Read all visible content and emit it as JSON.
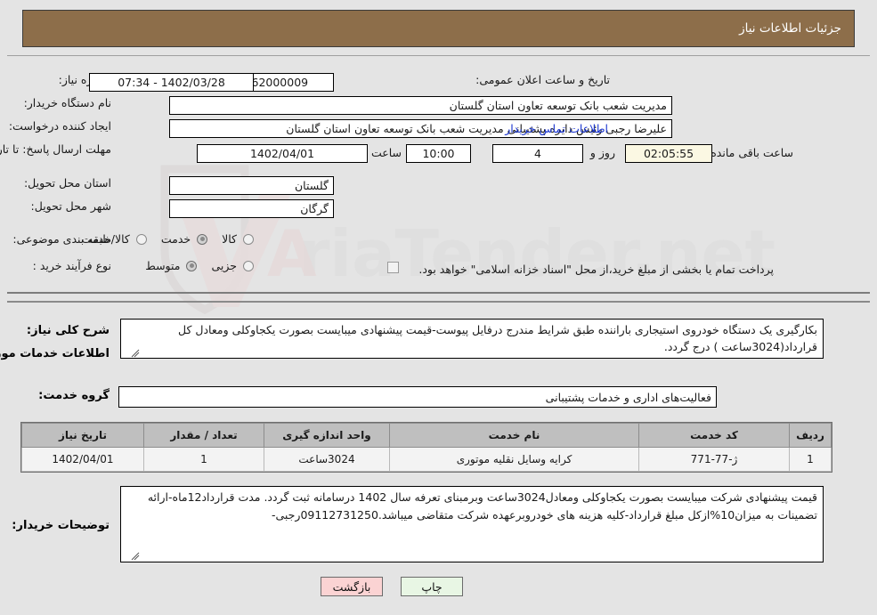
{
  "header": {
    "title": "جزئیات اطلاعات نیاز"
  },
  "form": {
    "need_number_label": "شماره نیاز:",
    "need_number_value": "1102003562000009",
    "public_announce_label": "تاریخ و ساعت اعلان عمومی:",
    "public_announce_value": "1402/03/28 - 07:34",
    "buyer_org_label": "نام دستگاه خریدار:",
    "buyer_org_value": "مدیریت شعب بانک توسعه تعاون استان گلستان",
    "requester_label": "ایجاد کننده درخواست:",
    "requester_value": "علیرضا رجبی رئیس دایره پشتیبانی مدیریت شعب بانک توسعه تعاون استان گلستان",
    "contact_link": "اطلاعات تماس خریدار",
    "deadline_label": "مهلت ارسال پاسخ: تا تاریخ:",
    "deadline_date": "1402/04/01",
    "deadline_hour_label": "ساعت",
    "deadline_hour_value": "10:00",
    "remaining_days_value": "4",
    "remaining_days_label": "روز و",
    "remaining_time_value": "02:05:55",
    "remaining_time_label": "ساعت باقی مانده",
    "province_label": "استان محل تحویل:",
    "province_value": "گلستان",
    "city_label": "شهر محل تحویل:",
    "city_value": "گرگان",
    "category_label": "طبقه بندی موضوعی:",
    "category_options": [
      {
        "label": "کالا",
        "selected": false
      },
      {
        "label": "خدمت",
        "selected": true
      },
      {
        "label": "کالا/خدمت",
        "selected": false
      }
    ],
    "process_type_label": "نوع فرآیند خرید :",
    "process_options": [
      {
        "label": "جزیی",
        "selected": false
      },
      {
        "label": "متوسط",
        "selected": true
      }
    ],
    "islamic_treasury_checked": false,
    "islamic_treasury_label": "پرداخت تمام یا بخشی از مبلغ خرید،از محل \"اسناد خزانه اسلامی\" خواهد بود."
  },
  "description": {
    "label": "شرح کلی نیاز:",
    "text": "بکارگیری یک دستگاه خودروی استیجاری باراننده طبق شرایط  مندرج درفایل پیوست-قیمت پیشنهادی میبایست بصورت یکجاوکلی ومعادل کل قرارداد(3024ساعت ) درج گردد."
  },
  "services_section": {
    "heading": "اطلاعات خدمات مورد نیاز",
    "group_label": "گروه خدمت:",
    "group_value": "فعالیت‌های اداری و خدمات پشتیبانی"
  },
  "table": {
    "headers": [
      "ردیف",
      "کد خدمت",
      "نام خدمت",
      "واحد اندازه گیری",
      "تعداد / مقدار",
      "تاریخ نیاز"
    ],
    "rows": [
      [
        "1",
        "ژ-77-771",
        "کرایه وسایل نقلیه موتوری",
        "3024ساعت",
        "1",
        "1402/04/01"
      ]
    ]
  },
  "buyer_notes": {
    "label": "توضیحات خریدار:",
    "text": "قیمت پیشنهادی  شرکت میبایست بصورت یکجاوکلی ومعادل3024ساعت وبرمبنای تعرفه سال 1402 درسامانه ثبت گردد. مدت قرارداد12ماه-ارائه تضمینات به میزان10%ازکل مبلغ قرارداد-کلیه هزینه های خودروبرعهده شرکت متقاضی میباشد.09112731250رجبی-"
  },
  "footer": {
    "print_label": "چاپ",
    "back_label": "بازگشت"
  },
  "watermark": {
    "text": "AriaTender.net"
  },
  "colors": {
    "header_brown": "#8d6e4a",
    "link_blue": "#1a35d0",
    "page_bg": "#e4e4e4",
    "table_header": "#bfbfbf",
    "btn_print": "#e8f6e4",
    "btn_back": "#fbd3d3"
  }
}
